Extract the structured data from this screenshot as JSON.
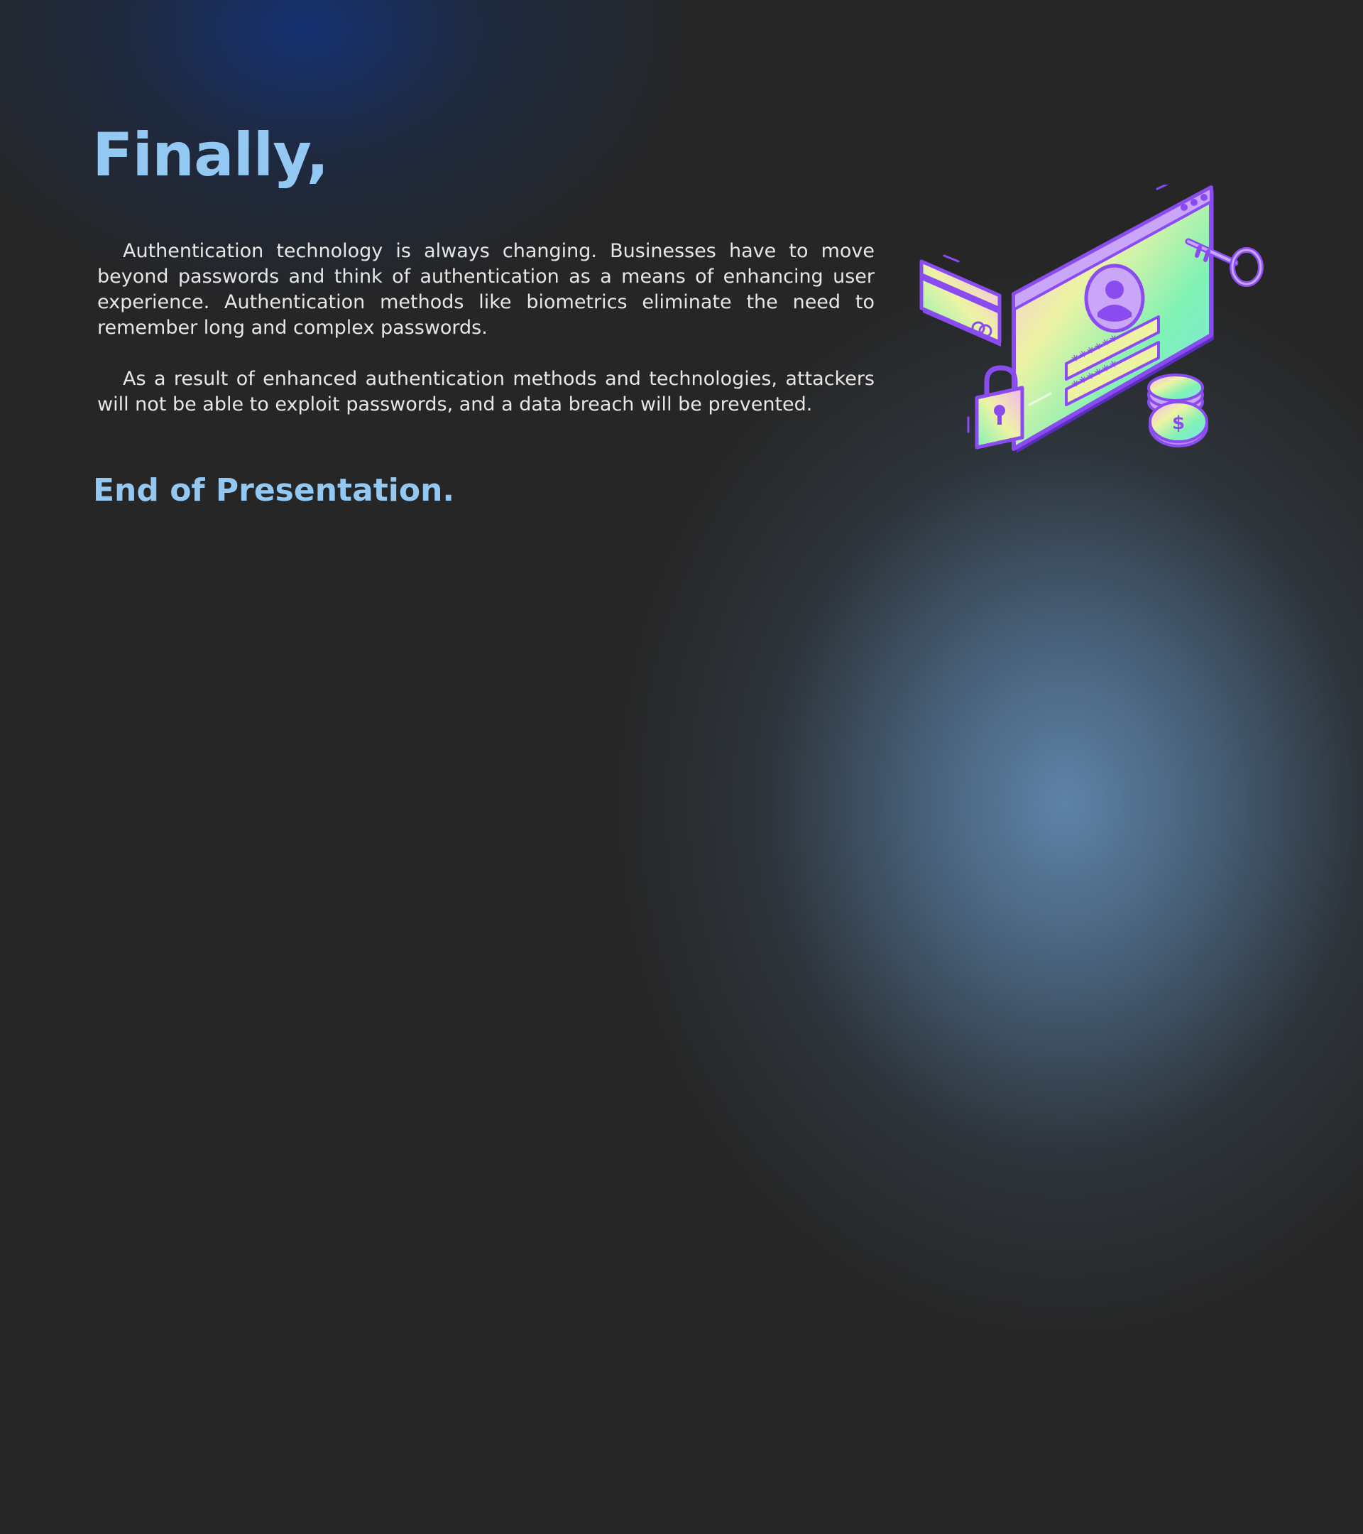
{
  "slide": {
    "heading": "Finally,",
    "paragraphs": [
      "Authentication technology is always changing. Businesses have to move beyond passwords and think of authentication as a means of enhancing user experience. Authentication methods like biometrics eliminate the need to remember long and complex passwords.",
      "As a result of enhanced authentication methods and technologies, attackers will not be able to exploit passwords, and a data breach will be prevented."
    ],
    "closing": "End of Presentation."
  },
  "illustration": {
    "password_mask_1": "******",
    "password_mask_2": "******",
    "coin_symbol": "$"
  },
  "colors": {
    "background": "#262626",
    "heading": "#93c8f2",
    "body_text": "#e6e6e6",
    "glow": "#628ab2",
    "illustration_outline": "#8a4cf0"
  }
}
